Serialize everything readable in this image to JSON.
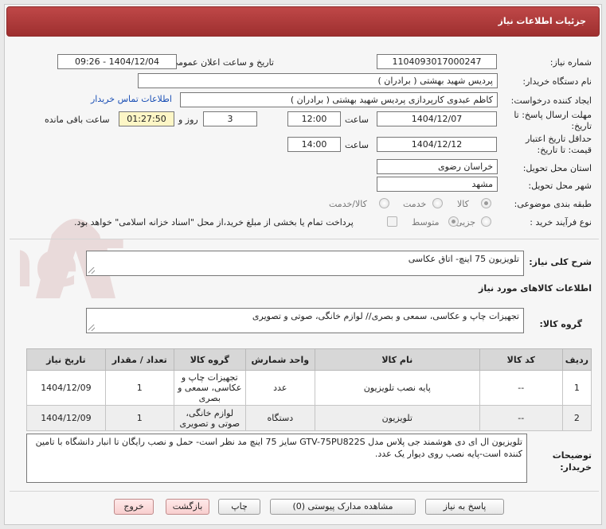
{
  "header": {
    "title": "جزئیات اطلاعات نیاز"
  },
  "fields": {
    "need_number_label": "شماره نیاز:",
    "need_number": "1104093017000247",
    "announce_label": "تاریخ و ساعت اعلان عمومی:",
    "announce_value": "1404/12/04 - 09:26",
    "buyer_org_label": "نام دستگاه خریدار:",
    "buyer_org": "پردیس شهید بهشتی ( برادران )",
    "creator_label": "ایجاد کننده درخواست:",
    "creator": "کاظم  عبدوی  کارپردازی  پردیس شهید بهشتی ( برادران )",
    "contact_link": "اطلاعات تماس خریدار",
    "deadline_label_1": "مهلت ارسال پاسخ: تا",
    "deadline_label_2": "تاریخ:",
    "deadline_date": "1404/12/07",
    "time_label": "ساعت",
    "deadline_time": "12:00",
    "days_value": "3",
    "days_label": "روز و",
    "remaining_value": "01:27:50",
    "remaining_label": "ساعت باقی مانده",
    "validity_label_1": "حداقل تاریخ اعتبار",
    "validity_label_2": "قیمت: تا تاریخ:",
    "validity_date": "1404/12/12",
    "validity_time": "14:00",
    "province_label": "استان محل تحویل:",
    "province": "خراسان رضوی",
    "city_label": "شهر محل تحویل:",
    "city": "مشهد",
    "category_label": "طبقه بندی موضوعی:",
    "category_options": [
      "کالا",
      "خدمت",
      "کالا/خدمت"
    ],
    "process_label": "نوع فرآیند خرید :",
    "process_options": [
      "جزیی",
      "متوسط"
    ],
    "payment_note": "پرداخت تمام یا بخشی از مبلغ خرید،از محل \"اسناد خزانه اسلامی\" خواهد بود."
  },
  "summary": {
    "label": "شرح کلی نیاز:",
    "value": "تلویزیون 75 اینچ- اتاق عکاسی"
  },
  "goods_info_title": "اطلاعات کالاهای مورد نیاز",
  "goods_group": {
    "label": "گروه کالا:",
    "value": "تجهیزات چاپ و عکاسی، سمعی و بصری// لوازم خانگی، صوتی و تصویری"
  },
  "table": {
    "headers": [
      "ردیف",
      "کد کالا",
      "نام کالا",
      "واحد شمارش",
      "گروه کالا",
      "تعداد / مقدار",
      "تاریخ نیاز"
    ],
    "rows": [
      [
        "1",
        "--",
        "پایه نصب تلویزیون",
        "عدد",
        "تجهیزات چاپ و عکاسی، سمعی و بصری",
        "1",
        "1404/12/09"
      ],
      [
        "2",
        "--",
        "تلویزیون",
        "دستگاه",
        "لوازم خانگی، صوتی و تصویری",
        "1",
        "1404/12/09"
      ]
    ]
  },
  "buyer_notes": {
    "label_1": "توضیحات",
    "label_2": "خریدار:",
    "value": "تلویزیون ال ای دی هوشمند جی پلاس مدل GTV-75PU822S سایز 75 اینچ مد نظر است- حمل و نصب رایگان تا انبار دانشگاه با تامین کننده است-پایه نصب روی دیوار یک عدد."
  },
  "buttons": {
    "reply": "پاسخ به نیاز",
    "docs": "مشاهده مدارک پیوستی (0)",
    "print": "چاپ",
    "back": "بازگشت",
    "exit": "خروج"
  },
  "watermark_text": "AriaTender.neT",
  "colors": {
    "header": "#b03c3c",
    "link": "#1a4fb5",
    "highlight": "#fdf6c6"
  }
}
